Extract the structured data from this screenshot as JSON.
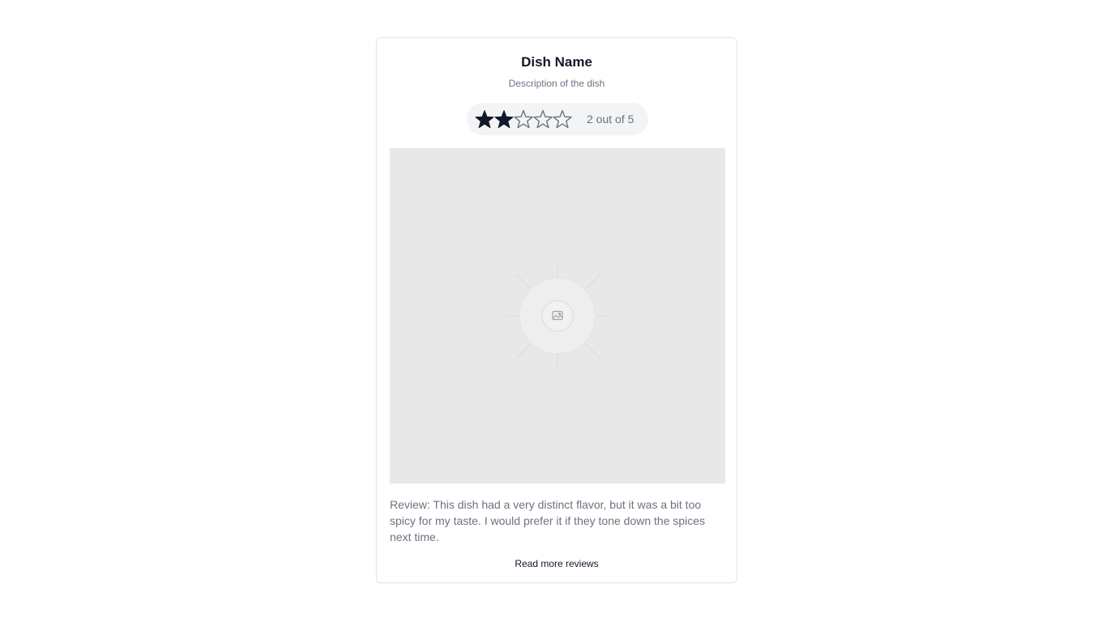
{
  "dish": {
    "name": "Dish Name",
    "description": "Description of the dish"
  },
  "rating": {
    "value": 2,
    "max": 5,
    "label": "2 out of 5",
    "star_filled_color": "#111827",
    "star_empty_color": "#6b7280"
  },
  "image": {
    "icon": "image-placeholder-icon"
  },
  "review": {
    "text": "Review: This dish had a very distinct flavor, but it was a bit too spicy for my taste. I would prefer it if they tone down the spices next time."
  },
  "actions": {
    "read_more_label": "Read more reviews"
  }
}
